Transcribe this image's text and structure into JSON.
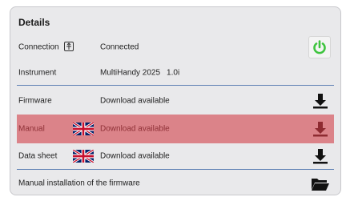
{
  "panel": {
    "title": "Details"
  },
  "rows": {
    "connection": {
      "label": "Connection",
      "value": "Connected",
      "status_color": "#3ec43e"
    },
    "instrument": {
      "label": "Instrument",
      "value": "MultiHandy 2025",
      "version": "1.0i"
    },
    "firmware": {
      "label": "Firmware",
      "value": "Download available"
    },
    "manual": {
      "label": "Manual",
      "value": "Download available"
    },
    "datasheet": {
      "label": "Data sheet",
      "value": "Download available"
    },
    "manual_install": {
      "label": "Manual installation of the firmware"
    }
  },
  "colors": {
    "highlight": "#d66068",
    "separator": "#5d7fb3",
    "power_button": "#3ec43e"
  },
  "icons": {
    "connection": "usb-plug-icon",
    "power": "power-icon",
    "download": "download-icon",
    "folder": "folder-open-icon",
    "flag": "uk-flag-icon"
  }
}
